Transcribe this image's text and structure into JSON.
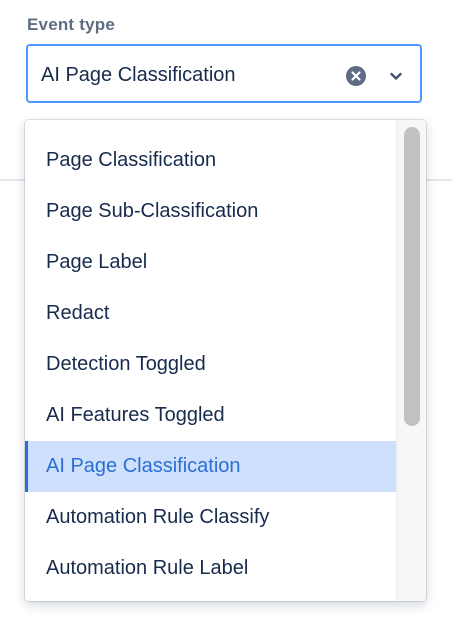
{
  "field": {
    "label": "Event type",
    "value": "AI Page Classification",
    "clear_icon": "clear-circle-x-icon",
    "dropdown_icon": "chevron-down-icon"
  },
  "menu": {
    "items": [
      {
        "label": "Page Classification",
        "selected": false
      },
      {
        "label": "Page Sub-Classification",
        "selected": false
      },
      {
        "label": "Page Label",
        "selected": false
      },
      {
        "label": "Redact",
        "selected": false
      },
      {
        "label": "Detection Toggled",
        "selected": false
      },
      {
        "label": "AI Features Toggled",
        "selected": false
      },
      {
        "label": "AI Page Classification",
        "selected": true
      },
      {
        "label": "Automation Rule Classify",
        "selected": false
      },
      {
        "label": "Automation Rule Label",
        "selected": false
      }
    ]
  },
  "colors": {
    "focus_border": "#4c9aff",
    "selected_bg": "#cfe0fc",
    "selected_text": "#2b6fd6",
    "text": "#172b4d",
    "label": "#5e6c84"
  }
}
